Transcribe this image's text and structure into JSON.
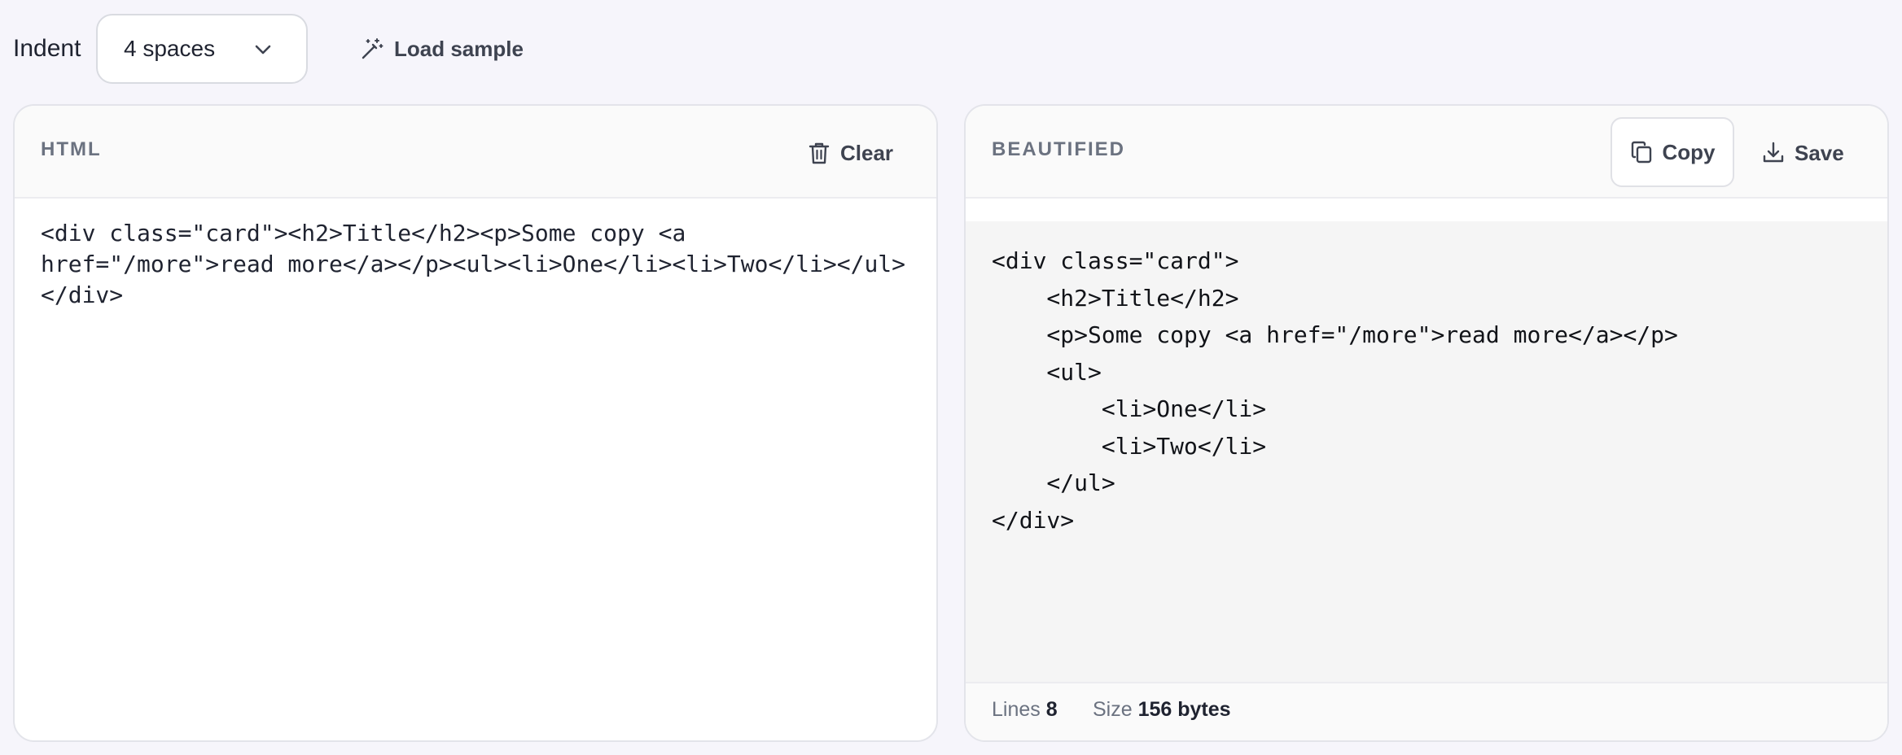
{
  "toolbar": {
    "indent_label": "Indent",
    "indent_value": "4 spaces",
    "load_sample_label": "Load sample"
  },
  "input_panel": {
    "title": "HTML",
    "clear_label": "Clear",
    "code": "<div class=\"card\"><h2>Title</h2><p>Some copy <a\nhref=\"/more\">read more</a></p><ul><li>One</li><li>Two</li></ul>\n</div>"
  },
  "output_panel": {
    "title": "BEAUTIFIED",
    "copy_label": "Copy",
    "save_label": "Save",
    "code": "<div class=\"card\">\n    <h2>Title</h2>\n    <p>Some copy <a href=\"/more\">read more</a></p>\n    <ul>\n        <li>One</li>\n        <li>Two</li>\n    </ul>\n</div>",
    "stats": {
      "lines_label": "Lines",
      "lines_value": "8",
      "size_label": "Size",
      "size_value": "156 bytes"
    }
  },
  "icons": {
    "indent_dropdown": "chevron-down-icon",
    "load_sample": "magic-wand-icon",
    "clear": "trash-icon",
    "copy": "copy-icon",
    "save": "download-icon"
  },
  "colors": {
    "page_bg": "#f6f5fb",
    "panel_bg": "#ffffff",
    "output_bg": "#f5f5f5",
    "muted_text": "#6b7280"
  }
}
